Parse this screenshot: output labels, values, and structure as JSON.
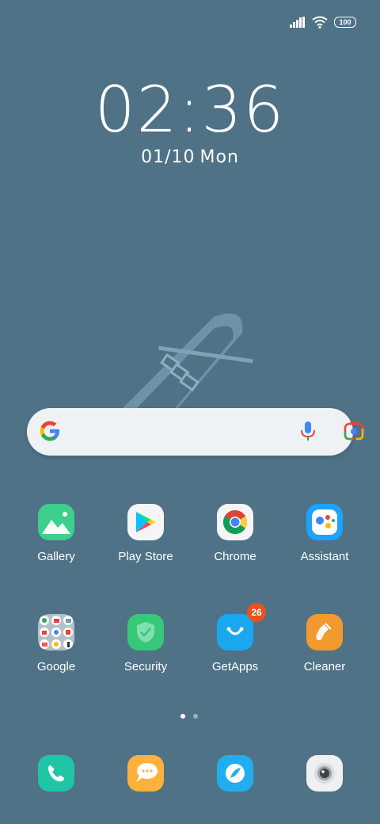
{
  "status_bar": {
    "battery": "100"
  },
  "lockclock": {
    "time": "02:36",
    "date": "01/10",
    "day": "Mon"
  },
  "search": {
    "provider": "Google"
  },
  "apps_row1": [
    {
      "label": "Gallery",
      "icon": "gallery-icon",
      "color": "#3dcf8e"
    },
    {
      "label": "Play Store",
      "icon": "play-store-icon",
      "color": "#f5f5f5"
    },
    {
      "label": "Chrome",
      "icon": "chrome-icon",
      "color": "#f5f5f5"
    },
    {
      "label": "Assistant",
      "icon": "assistant-icon",
      "color": "#1aa3ff"
    }
  ],
  "apps_row2": [
    {
      "label": "Google",
      "icon": "google-folder-icon",
      "color": "#b4c0c8"
    },
    {
      "label": "Security",
      "icon": "security-icon",
      "color": "#37c87a"
    },
    {
      "label": "GetApps",
      "icon": "getapps-icon",
      "color": "#1aa7f0",
      "badge": "26"
    },
    {
      "label": "Cleaner",
      "icon": "cleaner-icon",
      "color": "#f29a2e"
    }
  ],
  "pager": {
    "pages": 2,
    "current": 1
  },
  "dock": [
    {
      "icon": "phone-icon",
      "color": "#1ec6a6"
    },
    {
      "icon": "messages-icon",
      "color": "#ffb13b"
    },
    {
      "icon": "browser-icon",
      "color": "#21aef0"
    },
    {
      "icon": "camera-icon",
      "color": "#f0f0f0"
    }
  ]
}
